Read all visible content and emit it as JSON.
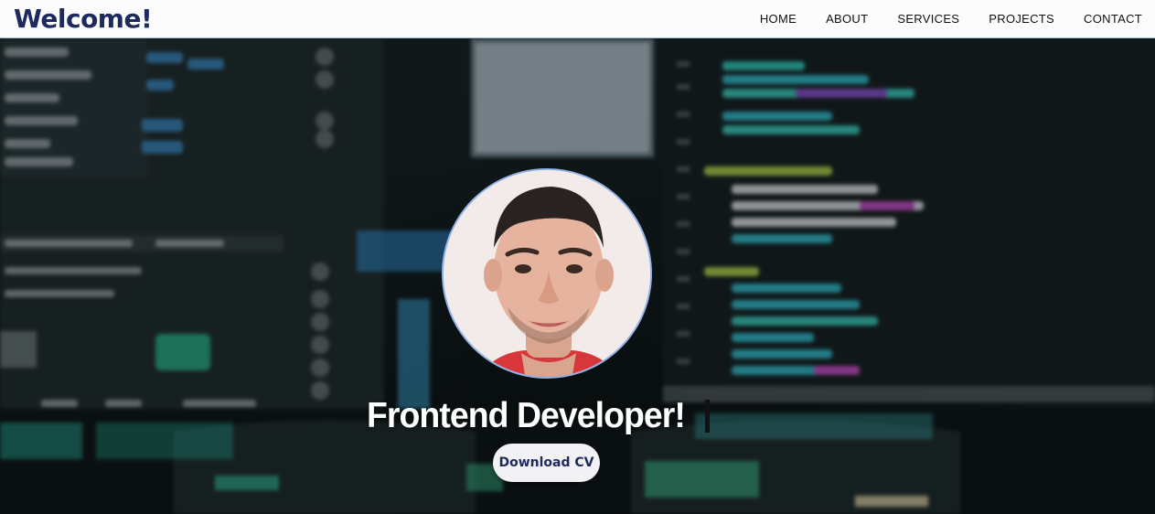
{
  "nav": {
    "brand": "Welcome!",
    "links": [
      "HOME",
      "ABOUT",
      "SERVICES",
      "PROJECTS",
      "CONTACT"
    ]
  },
  "hero": {
    "headline": "Frontend Developer!",
    "cta_label": "Download CV"
  },
  "colors": {
    "brand": "#1d2a5f",
    "navbar_bg": "#fcfcfd",
    "photo_border": "#8fb3e6",
    "button_bg": "#f2f2f4"
  }
}
